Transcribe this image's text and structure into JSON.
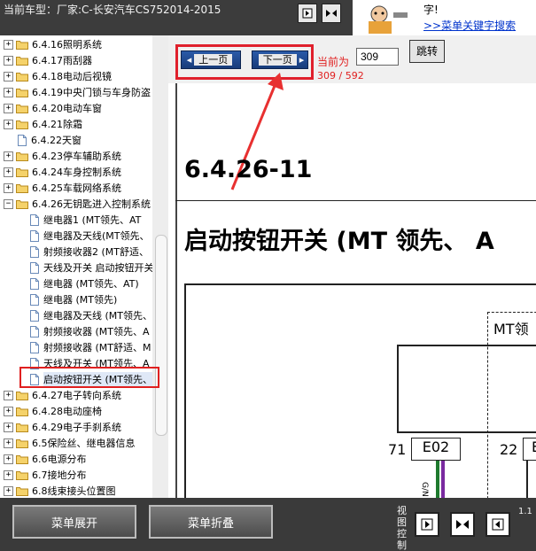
{
  "header": {
    "title": "当前车型：厂家:C-长安汽车CS752014-2015",
    "ad_line1": "字!",
    "ad_line2": ">>菜单关键字搜索"
  },
  "toolbar": {
    "icons": [
      "arrow-right-icon",
      "double-arrow-icon"
    ]
  },
  "sidebar": {
    "items": [
      {
        "label": "6.4.16照明系统",
        "type": "folder",
        "toggle": "+"
      },
      {
        "label": "6.4.17雨刮器",
        "type": "folder",
        "toggle": "+"
      },
      {
        "label": "6.4.18电动后视镜",
        "type": "folder",
        "toggle": "+"
      },
      {
        "label": "6.4.19中央门锁与车身防盗",
        "type": "folder",
        "toggle": "+"
      },
      {
        "label": "6.4.20电动车窗",
        "type": "folder",
        "toggle": "+"
      },
      {
        "label": "6.4.21除霜",
        "type": "folder",
        "toggle": "+"
      },
      {
        "label": "6.4.22天窗",
        "type": "doc",
        "toggle": ""
      },
      {
        "label": "6.4.23停车辅助系统",
        "type": "folder",
        "toggle": "+"
      },
      {
        "label": "6.4.24车身控制系统",
        "type": "folder",
        "toggle": "+"
      },
      {
        "label": "6.4.25车载网络系统",
        "type": "folder",
        "toggle": "+"
      },
      {
        "label": "6.4.26无钥匙进入控制系统",
        "type": "folder",
        "toggle": "-"
      },
      {
        "label": "继电器1 (MT领先、AT",
        "type": "doc",
        "toggle": ""
      },
      {
        "label": "继电器及天线(MT领先、",
        "type": "doc",
        "toggle": ""
      },
      {
        "label": "射频接收器2 (MT舒适、",
        "type": "doc",
        "toggle": ""
      },
      {
        "label": "天线及开关 启动按钮开关",
        "type": "doc",
        "toggle": ""
      },
      {
        "label": "继电器 (MT领先、AT)",
        "type": "doc",
        "toggle": ""
      },
      {
        "label": "继电器 (MT领先)",
        "type": "doc",
        "toggle": ""
      },
      {
        "label": "继电器及天线 (MT领先、",
        "type": "doc",
        "toggle": ""
      },
      {
        "label": "射频接收器 (MT领先、A",
        "type": "doc",
        "toggle": ""
      },
      {
        "label": "射频接收器 (MT舒适、M",
        "type": "doc",
        "toggle": ""
      },
      {
        "label": "天线及开关 (MT领先、A",
        "type": "doc",
        "toggle": ""
      },
      {
        "label": "启动按钮开关 (MT领先、",
        "type": "doc",
        "toggle": "",
        "selected": true
      },
      {
        "label": "6.4.27电子转向系统",
        "type": "folder",
        "toggle": "+"
      },
      {
        "label": "6.4.28电动座椅",
        "type": "folder",
        "toggle": "+"
      },
      {
        "label": "6.4.29电子手刹系统",
        "type": "folder",
        "toggle": "+"
      },
      {
        "label": "6.5保险丝、继电器信息",
        "type": "folder",
        "toggle": "+"
      },
      {
        "label": "6.6电源分布",
        "type": "folder",
        "toggle": "+"
      },
      {
        "label": "6.7接地分布",
        "type": "folder",
        "toggle": "+"
      },
      {
        "label": "6.8线束接头位置图",
        "type": "folder",
        "toggle": "+"
      }
    ]
  },
  "nav": {
    "prev_label": "上一页",
    "next_label": "下一页",
    "current_label": "当前为",
    "page_value": "309",
    "jump_label": "跳转",
    "page_count": "309 / 592"
  },
  "document": {
    "number": "6.4.26-11",
    "title": "启动按钮开关 (MT 领先、 A",
    "mt_label": "MT领",
    "component_letter": "E",
    "pins": [
      {
        "num": "71",
        "connector": "E02"
      },
      {
        "num": "22",
        "connector": "E"
      }
    ],
    "wire_label": "G/N"
  },
  "bottom": {
    "expand_label": "菜单展开",
    "collapse_label": "菜单折叠",
    "view_label": "视图控制",
    "zoom": "1.1"
  },
  "colors": {
    "highlight": "#e02020",
    "nav_button": "#1e4a90",
    "wire_green": "#1e7a2e",
    "wire_purple": "#7a2aa0"
  }
}
